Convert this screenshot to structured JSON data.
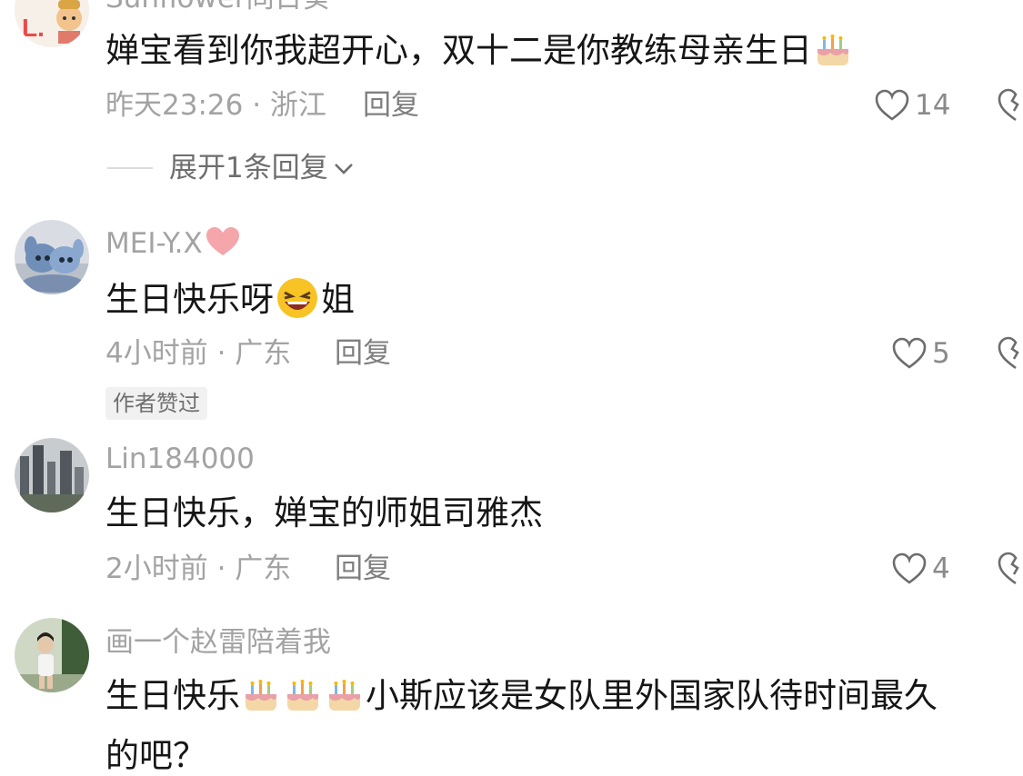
{
  "comments": [
    {
      "username": "Sunflower冏日葵",
      "text": "婵宝看到你我超开心，双十二是你教练母亲生日",
      "emojis": [
        "birthday-cake"
      ],
      "time": "昨天23:26",
      "location": "浙江",
      "reply_label": "回复",
      "likes": "14",
      "expand_label": "展开1条回复"
    },
    {
      "username": "MEI-Y.X",
      "username_emoji": "pink-heart",
      "text_before": "生日快乐呀",
      "emoji": "laughing-face",
      "text_after": "姐",
      "time": "4小时前",
      "location": "广东",
      "reply_label": "回复",
      "likes": "5",
      "badge": "作者赞过"
    },
    {
      "username": "Lin184000",
      "text": "生日快乐，婵宝的师姐司雅杰",
      "time": "2小时前",
      "location": "广东",
      "reply_label": "回复",
      "likes": "4"
    },
    {
      "username": "画一个赵雷陪着我",
      "text_before": "生日快乐",
      "emojis": [
        "birthday-cake",
        "birthday-cake",
        "birthday-cake"
      ],
      "text_after": "小斯应该是女队里外国家队待时间最久",
      "text_line2": "的吧？"
    }
  ],
  "meta_separator": " · ",
  "colors": {
    "meta_gray": "#a3a3a3",
    "body_text": "#161616",
    "badge_bg": "#f1f1f1"
  }
}
